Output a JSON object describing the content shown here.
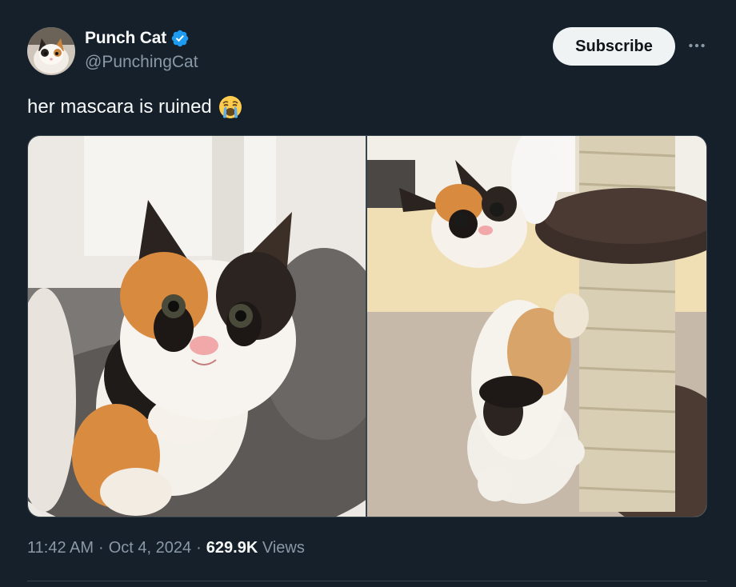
{
  "author": {
    "display_name": "Punch Cat",
    "handle": "@PunchingCat",
    "verified": true
  },
  "actions": {
    "subscribe_label": "Subscribe",
    "more_icon": "more-horizontal-icon"
  },
  "tweet": {
    "text": "her mascara is ruined",
    "emoji": "loudly-crying-face-emoji"
  },
  "media": {
    "photo_count": 2
  },
  "meta": {
    "time": "11:42 AM",
    "sep1": "·",
    "date": "Oct 4, 2024",
    "sep2": "·",
    "views_count": "629.9K",
    "views_label": "Views"
  },
  "colors": {
    "background": "#15202b",
    "secondary_text": "#8b98a5",
    "verified_blue": "#1d9bf0",
    "subscribe_bg": "#eff3f4"
  }
}
